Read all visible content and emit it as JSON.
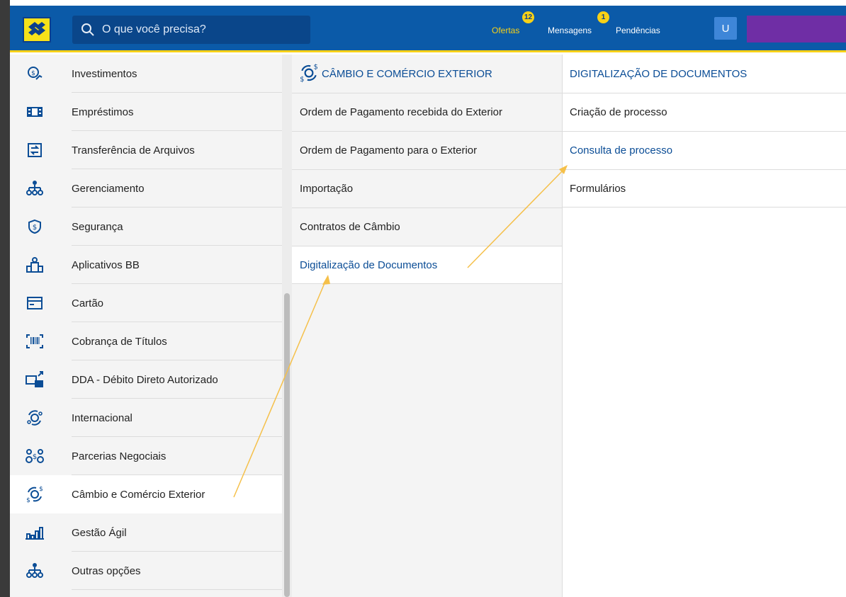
{
  "header": {
    "search_placeholder": "O que você precisa?",
    "links": {
      "ofertas": "Ofertas",
      "mensagens": "Mensagens",
      "pendencias": "Pendências"
    },
    "badges": {
      "ofertas": "12",
      "mensagens": "1"
    },
    "user_initial": "U",
    "colors": {
      "bar": "#0b5aa8",
      "accent": "#f7d117",
      "user_bar": "#6f2ea5"
    }
  },
  "sidebar": {
    "items": [
      {
        "label": "Investimentos",
        "icon": "investment-icon"
      },
      {
        "label": "Empréstimos",
        "icon": "loan-icon"
      },
      {
        "label": "Transferência de Arquivos",
        "icon": "file-transfer-icon"
      },
      {
        "label": "Gerenciamento",
        "icon": "management-icon"
      },
      {
        "label": "Segurança",
        "icon": "security-shield-icon"
      },
      {
        "label": "Aplicativos BB",
        "icon": "apps-icon"
      },
      {
        "label": "Cartão",
        "icon": "card-icon"
      },
      {
        "label": "Cobrança de Títulos",
        "icon": "barcode-icon"
      },
      {
        "label": "DDA - Débito Direto Autorizado",
        "icon": "dda-icon"
      },
      {
        "label": "Internacional",
        "icon": "globe-icon"
      },
      {
        "label": "Parcerias Negociais",
        "icon": "partners-icon"
      },
      {
        "label": "Câmbio e Comércio Exterior",
        "icon": "exchange-icon"
      },
      {
        "label": "Gestão Ágil",
        "icon": "chart-bars-icon"
      },
      {
        "label": "Outras opções",
        "icon": "other-options-icon"
      }
    ]
  },
  "submenu": {
    "title": "CÂMBIO E COMÉRCIO EXTERIOR",
    "items": [
      "Ordem de Pagamento recebida do Exterior",
      "Ordem de Pagamento para o Exterior",
      "Importação",
      "Contratos de Câmbio",
      "Digitalização de Documentos"
    ]
  },
  "subsubmenu": {
    "title": "DIGITALIZAÇÃO DE DOCUMENTOS",
    "items": [
      "Criação de processo",
      "Consulta de processo",
      "Formulários"
    ]
  }
}
